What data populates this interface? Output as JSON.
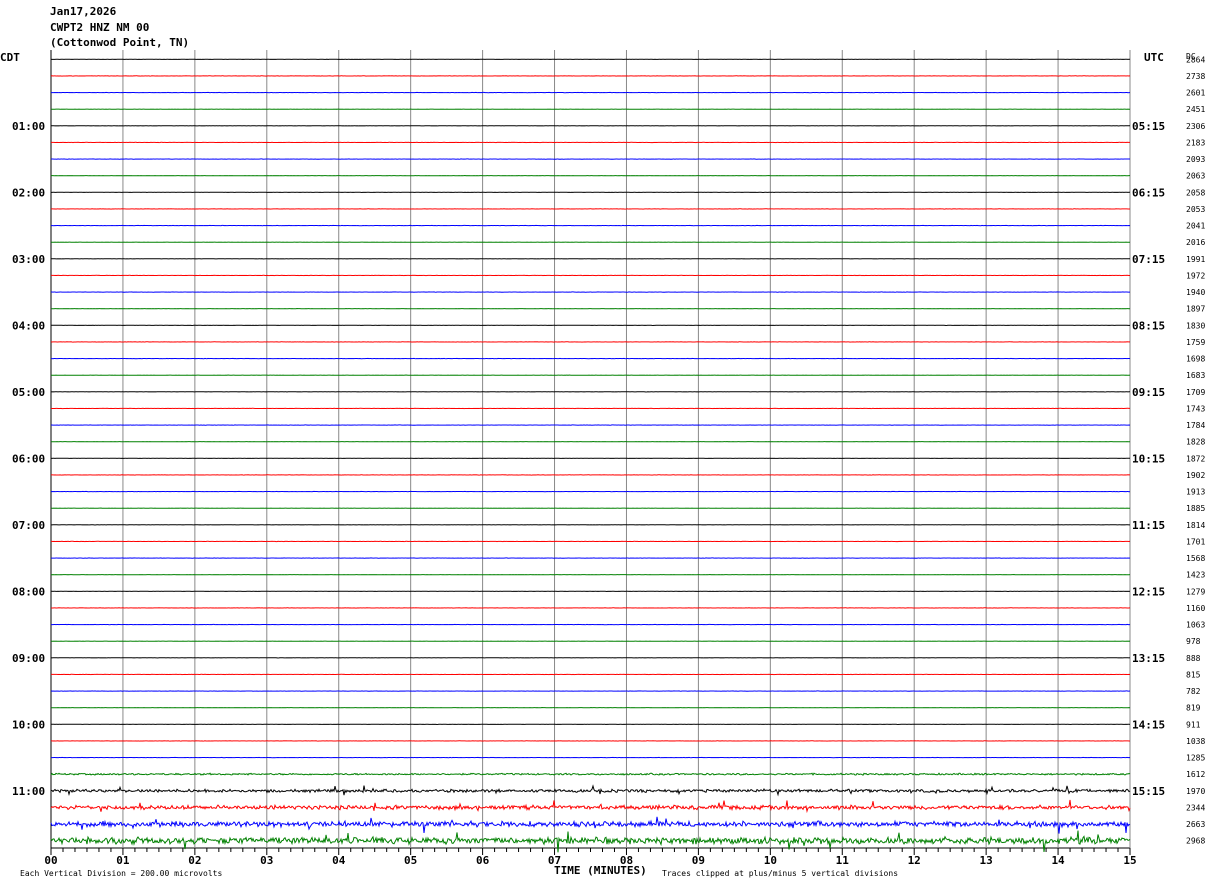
{
  "header": {
    "date": "Jan17,2026",
    "station": "CWPT2 HNZ NM 00",
    "location": "(Cottonwod Point, TN)"
  },
  "left_tz_label": "CDT",
  "right_tz_label": "UTC",
  "dc_label": "DC",
  "x_axis_label": "TIME (MINUTES)",
  "footer": {
    "scale_note": "Each Vertical Division =  200.00 microvolts",
    "clip_note": "Traces clipped at plus/minus 5 vertical divisions"
  },
  "chart_data": {
    "type": "line",
    "title": "",
    "xlabel": "TIME (MINUTES)",
    "x_range": [
      0,
      15
    ],
    "x_ticks": [
      "00",
      "01",
      "02",
      "03",
      "04",
      "05",
      "06",
      "07",
      "08",
      "09",
      "10",
      "11",
      "12",
      "13",
      "14",
      "15"
    ],
    "trace_count": 48,
    "trace_interval_minutes": 15,
    "colors": [
      "#000000",
      "#ff0000",
      "#0000ff",
      "#008000"
    ],
    "left_hour_labels": [
      "01:00",
      "02:00",
      "03:00",
      "04:00",
      "05:00",
      "06:00",
      "07:00",
      "08:00",
      "09:00",
      "10:00",
      "11:00"
    ],
    "right_hour_labels": [
      "05:15",
      "06:15",
      "07:15",
      "08:15",
      "09:15",
      "10:15",
      "11:15",
      "12:15",
      "13:15",
      "14:15",
      "15:15"
    ],
    "dc_values": [
      2864,
      2738,
      2601,
      2451,
      2306,
      2183,
      2093,
      2063,
      2058,
      2053,
      2041,
      2016,
      1991,
      1972,
      1940,
      1897,
      1830,
      1759,
      1698,
      1683,
      1709,
      1743,
      1784,
      1828,
      1872,
      1902,
      1913,
      1885,
      1814,
      1701,
      1568,
      1423,
      1279,
      1160,
      1063,
      978,
      888,
      815,
      782,
      819,
      911,
      1038,
      1285,
      1612,
      1970,
      2344,
      2663,
      2968
    ],
    "grid": true
  }
}
